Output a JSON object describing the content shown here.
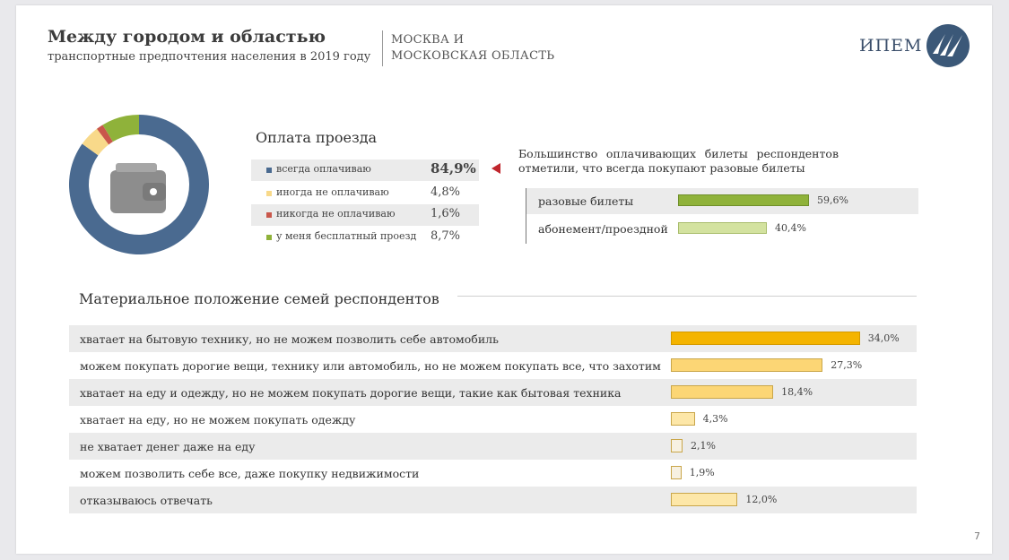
{
  "header": {
    "title": "Между городом и областью",
    "subtitle": "транспортные предпочтения населения в 2019 году",
    "region_line1": "МОСКВА И",
    "region_line2": "МОСКОВСКАЯ ОБЛАСТЬ",
    "brand": "ИПЕМ"
  },
  "page_number": "7",
  "payment": {
    "title": "Оплата проезда",
    "note": "Большинство оплачивающих билеты респондентов отметили, что всегда покупают разовые билеты",
    "legend": [
      {
        "label": "всегда оплачиваю",
        "value_text": "84,9%",
        "color": "#4a6a90"
      },
      {
        "label": "иногда не оплачиваю",
        "value_text": "4,8%",
        "color": "#f8d98a"
      },
      {
        "label": "никогда не оплачиваю",
        "value_text": "1,6%",
        "color": "#c9574b"
      },
      {
        "label": "у меня бесплатный проезд",
        "value_text": "8,7%",
        "color": "#8fb23a"
      }
    ],
    "tickets": [
      {
        "label": "разовые билеты",
        "value_text": "59,6%"
      },
      {
        "label": "абонемент/проездной",
        "value_text": "40,4%"
      }
    ]
  },
  "family": {
    "title": "Материальное положение семей респондентов",
    "rows": [
      {
        "label": "хватает на бытовую технику, но не можем позволить себе автомобиль",
        "value_text": "34,0%"
      },
      {
        "label": "можем покупать дорогие вещи, технику или автомобиль, но не можем покупать все, что захотим",
        "value_text": "27,3%"
      },
      {
        "label": "хватает на еду и одежду, но не можем покупать дорогие вещи, такие как бытовая техника",
        "value_text": "18,4%"
      },
      {
        "label": "хватает на еду, но не можем покупать одежду",
        "value_text": "4,3%"
      },
      {
        "label": "не хватает денег даже на еду",
        "value_text": "2,1%"
      },
      {
        "label": "можем позволить себе все, даже покупку недвижимости",
        "value_text": "1,9%"
      },
      {
        "label": "отказываюсь отвечать",
        "value_text": "12,0%"
      }
    ]
  },
  "chart_data": [
    {
      "type": "pie",
      "title": "Оплата проезда",
      "categories": [
        "всегда оплачиваю",
        "иногда не оплачиваю",
        "никогда не оплачиваю",
        "у меня бесплатный проезд"
      ],
      "values": [
        84.9,
        4.8,
        1.6,
        8.7
      ],
      "colors": [
        "#4a6a90",
        "#f8d98a",
        "#c9574b",
        "#8fb23a"
      ]
    },
    {
      "type": "bar",
      "categories": [
        "разовые билеты",
        "абонемент/проездной"
      ],
      "values": [
        59.6,
        40.4
      ],
      "colors": [
        "#8fb23a",
        "#d3e29f"
      ],
      "xlim": [
        0,
        100
      ]
    },
    {
      "type": "bar",
      "title": "Материальное положение семей респондентов",
      "categories": [
        "хватает на бытовую технику, но не можем позволить себе автомобиль",
        "можем покупать дорогие вещи, технику или автомобиль, но не можем покупать все, что захотим",
        "хватает на еду и одежду, но не можем покупать дорогие вещи, такие как бытовая техника",
        "хватает на еду, но не можем покупать одежду",
        "не хватает денег даже на еду",
        "можем позволить себе все, даже покупку недвижимости",
        "отказываюсь отвечать"
      ],
      "values": [
        34.0,
        27.3,
        18.4,
        4.3,
        2.1,
        1.9,
        12.0
      ],
      "colors": [
        "#f4b400",
        "#fcd675",
        "#fcd675",
        "#fde7a8",
        "#f7f1e2",
        "#f7f1e2",
        "#fde7a8"
      ],
      "xlim": [
        0,
        100
      ]
    }
  ]
}
